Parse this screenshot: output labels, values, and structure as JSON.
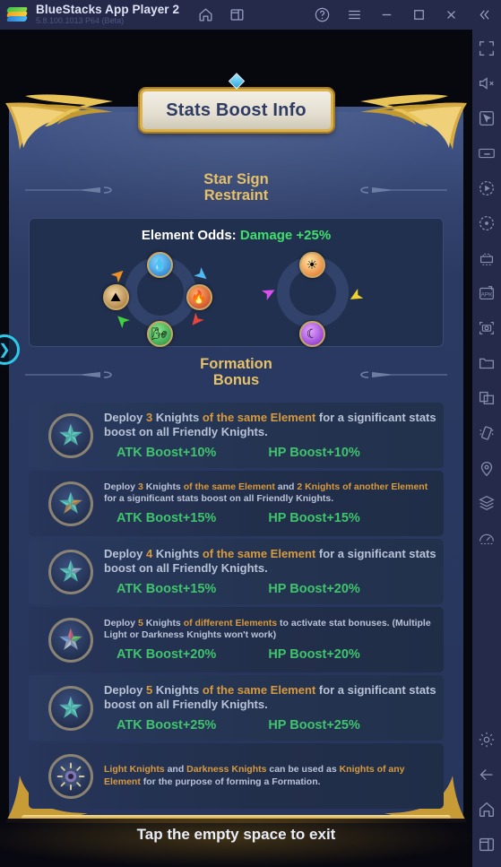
{
  "titlebar": {
    "app_title": "BlueStacks App Player 2",
    "version": "5.8.100.1013  P64 (Beta)",
    "logo_icon": "bluestacks-logo",
    "nav_icons": [
      "home-icon",
      "multi-window-icon"
    ],
    "window_icons": [
      "help-icon",
      "menu-icon",
      "minimize-icon",
      "maximize-icon",
      "close-icon",
      "collapse-icon"
    ]
  },
  "rail": {
    "icons": [
      "fullscreen-icon",
      "mute-icon",
      "cursor-icon",
      "keyboard-icon",
      "macro-record-icon",
      "rotate-icon",
      "multi-instance-icon",
      "install-apk-icon",
      "screenshot-icon",
      "folder-icon",
      "copy-paste-icon",
      "shake-icon",
      "location-icon",
      "layers-icon",
      "performance-icon"
    ],
    "bottom_icons": [
      "settings-icon",
      "back-icon",
      "home-icon",
      "recents-icon"
    ]
  },
  "side_arrow": {
    "icon": "expand-arrow-icon"
  },
  "dialog": {
    "title": "Stats Boost Info",
    "sections": {
      "star_sign": {
        "line1": "Star Sign",
        "line2": "Restraint"
      },
      "formation": {
        "line1": "Formation",
        "line2": "Bonus"
      }
    },
    "element_odds": {
      "label": "Element Odds: ",
      "value": "Damage +25%",
      "value_color": "#3fe06a",
      "wheel_primary": {
        "elements": [
          "water-icon",
          "fire-icon",
          "wind-icon",
          "earth-icon"
        ],
        "glyphs": [
          "◆",
          "▲",
          "●",
          "▰"
        ]
      },
      "wheel_secondary": {
        "elements": [
          "light-icon",
          "darkness-icon"
        ],
        "glyphs": [
          "☀",
          "☽"
        ]
      }
    },
    "formation_rows": [
      {
        "badge": "formation-star-3-same",
        "size": "lg",
        "parts": [
          {
            "t": "Deploy ",
            "h": false
          },
          {
            "t": "3",
            "h": true
          },
          {
            "t": " Knights ",
            "h": false
          },
          {
            "t": "of the same Element",
            "h": true
          },
          {
            "t": " for a significant stats boost on all Friendly Knights.",
            "h": false
          }
        ],
        "atk": "ATK Boost+10%",
        "hp": "HP Boost+10%"
      },
      {
        "badge": "formation-star-3-plus-2",
        "size": "sm",
        "parts": [
          {
            "t": "Deploy ",
            "h": false
          },
          {
            "t": "3",
            "h": true
          },
          {
            "t": " Knights ",
            "h": false
          },
          {
            "t": "of the same Element",
            "h": true
          },
          {
            "t": " and ",
            "h": false
          },
          {
            "t": "2 Knights of another Element",
            "h": true
          },
          {
            "t": " for a significant stats boost on all Friendly Knights.",
            "h": false
          }
        ],
        "atk": "ATK Boost+15%",
        "hp": "HP Boost+15%"
      },
      {
        "badge": "formation-star-4-same",
        "size": "lg",
        "parts": [
          {
            "t": "Deploy ",
            "h": false
          },
          {
            "t": "4",
            "h": true
          },
          {
            "t": " Knights ",
            "h": false
          },
          {
            "t": "of the same Element",
            "h": true
          },
          {
            "t": " for a significant stats boost on all Friendly Knights.",
            "h": false
          }
        ],
        "atk": "ATK Boost+15%",
        "hp": "HP Boost+20%"
      },
      {
        "badge": "formation-star-5-different",
        "size": "sm",
        "parts": [
          {
            "t": "Deploy ",
            "h": false
          },
          {
            "t": "5",
            "h": true
          },
          {
            "t": " Knights ",
            "h": false
          },
          {
            "t": "of different Elements",
            "h": true
          },
          {
            "t": " to activate stat bonuses. (Multiple Light or Darkness Knights won't work)",
            "h": false
          }
        ],
        "atk": "ATK Boost+20%",
        "hp": "HP Boost+20%"
      },
      {
        "badge": "formation-star-5-same",
        "size": "lg",
        "parts": [
          {
            "t": "Deploy ",
            "h": false
          },
          {
            "t": "5",
            "h": true
          },
          {
            "t": " Knights ",
            "h": false
          },
          {
            "t": "of the same Element",
            "h": true
          },
          {
            "t": " for a significant stats boost on all Friendly Knights.",
            "h": false
          }
        ],
        "atk": "ATK Boost+25%",
        "hp": "HP Boost+25%"
      },
      {
        "badge": "formation-wildcard",
        "size": "sm",
        "parts": [
          {
            "t": "Light Knights",
            "h": true
          },
          {
            "t": " and ",
            "h": false
          },
          {
            "t": "Darkness Knights",
            "h": true
          },
          {
            "t": " can be used as ",
            "h": false
          },
          {
            "t": "Knights of any Element",
            "h": true
          },
          {
            "t": " for the purpose of forming a Formation.",
            "h": false
          }
        ],
        "atk": "",
        "hp": ""
      }
    ]
  },
  "footer": {
    "text": "Tap the empty space to exit"
  }
}
